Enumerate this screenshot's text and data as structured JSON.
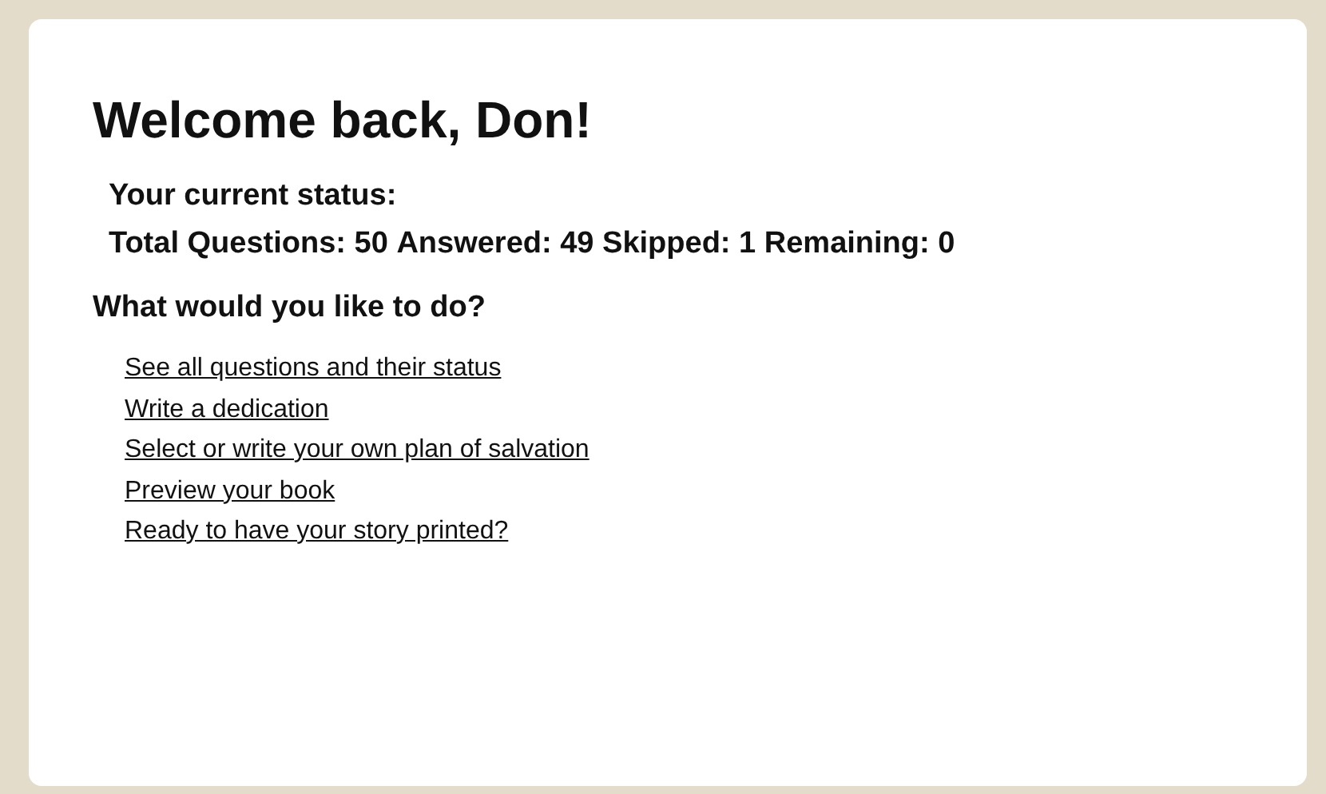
{
  "heading": "Welcome back, Don!",
  "status": {
    "title": "Your current status:",
    "summary": "Total Questions: 50 **Answered:** 49 **Skipped:** 1 **Remaining:** 0"
  },
  "actions": {
    "title": "What would you like to do?",
    "links": [
      "See all questions and their status",
      "Write a dedication",
      "Select or write your own plan of salvation",
      "Preview your book",
      "Ready to have your story printed?"
    ]
  }
}
